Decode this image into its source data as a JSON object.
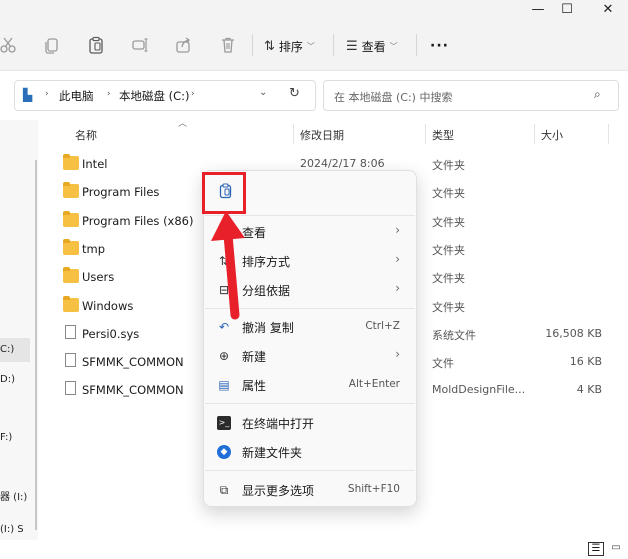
{
  "window": {
    "controls": [
      "—",
      "☐",
      "✕"
    ]
  },
  "toolbar": {
    "sort_label": "排序",
    "view_label": "查看",
    "more_label": "···"
  },
  "address": {
    "crumbs": [
      "此电脑",
      "本地磁盘 (C:)"
    ],
    "search_placeholder": "在 本地磁盘 (C:) 中搜索"
  },
  "nav": {
    "items": [
      "C:)",
      "D:)",
      "F:)",
      "器 (I:)",
      "(I:) S"
    ]
  },
  "columns": {
    "name": "名称",
    "date": "修改日期",
    "type": "类型",
    "size": "大小"
  },
  "files": [
    {
      "name": "Intel",
      "date": "2024/2/17 8:06",
      "type": "文件夹",
      "size": "",
      "kind": "folder"
    },
    {
      "name": "Program Files",
      "date": "",
      "type": "文件夹",
      "size": "",
      "kind": "folder"
    },
    {
      "name": "Program Files (x86)",
      "date": "",
      "type": "文件夹",
      "size": "",
      "kind": "folder"
    },
    {
      "name": "tmp",
      "date": "",
      "type": "文件夹",
      "size": "",
      "kind": "folder"
    },
    {
      "name": "Users",
      "date": "",
      "type": "文件夹",
      "size": "",
      "kind": "folder"
    },
    {
      "name": "Windows",
      "date": "",
      "type": "文件夹",
      "size": "",
      "kind": "folder"
    },
    {
      "name": "Persi0.sys",
      "date": "",
      "type": "系统文件",
      "size": "16,508 KB",
      "kind": "file"
    },
    {
      "name": "SFMMK_COMMON",
      "date": "",
      "type": "文件",
      "size": "16 KB",
      "kind": "file"
    },
    {
      "name": "SFMMK_COMMON",
      "date": "",
      "type": "MoldDesignFile...",
      "size": "4 KB",
      "kind": "file"
    }
  ],
  "context_menu": {
    "view": "查看",
    "sort": "排序方式",
    "group": "分组依据",
    "undo": "撤消 复制",
    "undo_shortcut": "Ctrl+Z",
    "new": "新建",
    "properties": "属性",
    "properties_shortcut": "Alt+Enter",
    "terminal": "在终端中打开",
    "new_folder": "新建文件夹",
    "more_options": "显示更多选项",
    "more_shortcut": "Shift+F10"
  },
  "colors": {
    "highlight": "#e8202a",
    "folder": "#f6c143",
    "accent": "#0067c0"
  }
}
